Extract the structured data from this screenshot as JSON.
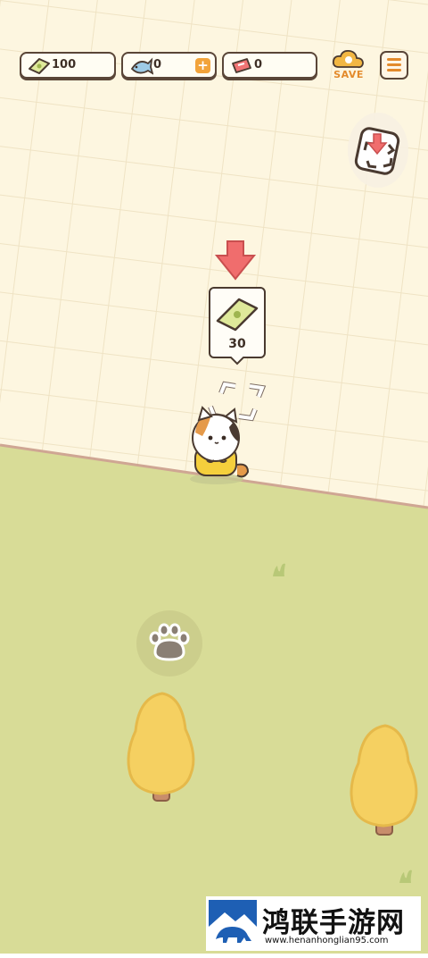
{
  "hud": {
    "cash": {
      "icon": "cash-icon",
      "value": "100"
    },
    "fish": {
      "icon": "fish-icon",
      "value": "0",
      "plus": "+"
    },
    "ticket": {
      "icon": "ticket-icon",
      "value": "0"
    },
    "save": {
      "icon": "cloud-save-icon",
      "label": "SAVE"
    },
    "menu": {
      "icon": "menu-icon"
    }
  },
  "placement_button": {
    "icon": "place-item-icon"
  },
  "purchase_bubble": {
    "icon": "cash-icon",
    "cost": "30"
  },
  "paw_button": {
    "icon": "paw-icon"
  },
  "watermark": {
    "title": "鸿联手游网",
    "url": "www.henanhonglian95.com",
    "logo": "bison-logo"
  },
  "colors": {
    "floor": "#fdf6e0",
    "grid": "#eee3c7",
    "grass": "#d8dc97",
    "arrow": "#f06d6d",
    "outline": "#5a4638",
    "accent": "#e38a2b",
    "tree": "#f5d061"
  }
}
